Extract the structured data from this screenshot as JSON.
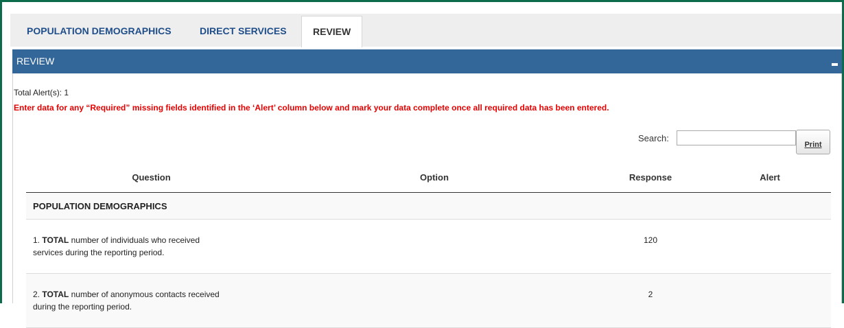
{
  "tabs": [
    {
      "label": "POPULATION DEMOGRAPHICS"
    },
    {
      "label": "DIRECT SERVICES"
    },
    {
      "label": "REVIEW"
    }
  ],
  "panel": {
    "title": "REVIEW"
  },
  "alerts": {
    "total_label": "Total Alert(s): 1",
    "message": "Enter data for any “Required” missing fields identified in the ‘Alert’ column below and mark your data complete once all required data has been entered."
  },
  "search": {
    "label": "Search:",
    "value": ""
  },
  "print_label": "Print",
  "table": {
    "headers": [
      "Question",
      "Option",
      "Response",
      "Alert"
    ],
    "section": "POPULATION DEMOGRAPHICS",
    "rows": [
      {
        "num": "1.",
        "bold": "TOTAL",
        "line1_rest": "number of individuals who received",
        "line2": "services during the reporting period.",
        "option": "",
        "response": "120",
        "alert": ""
      },
      {
        "num": "2.",
        "bold": "TOTAL",
        "line1_rest": "number of anonymous contacts received",
        "line2": "during the reporting period.",
        "option": "",
        "response": "2",
        "alert": ""
      }
    ]
  }
}
